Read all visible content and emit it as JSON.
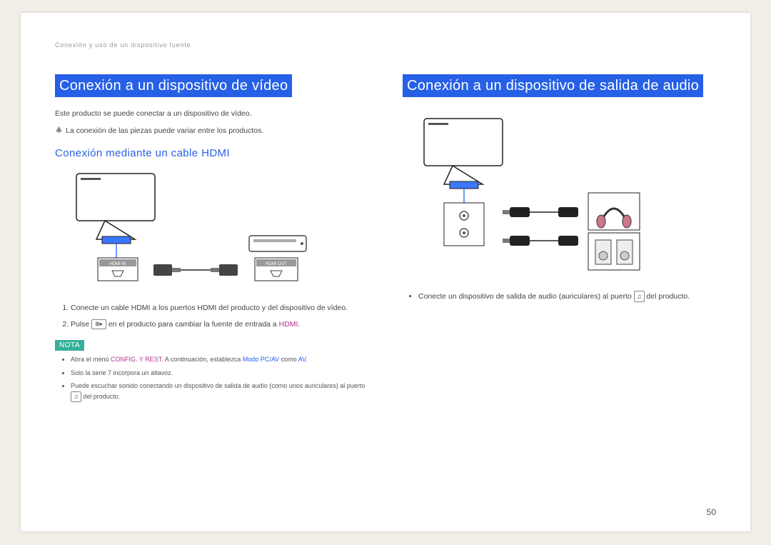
{
  "breadcrumb": "Conexión y uso de un dispositivo fuente",
  "page_number": "50",
  "left": {
    "heading": "Conexión a un dispositivo de vídeo",
    "intro": "Este producto se puede conectar a un dispositivo de vídeo.",
    "info_note": "La conexión de las piezas puede variar entre los productos.",
    "subheading": "Conexión mediante un cable HDMI",
    "labels": {
      "hdmi_in": "HDMI IN",
      "hdmi_out": "HDMI OUT"
    },
    "step1": "Conecte un cable HDMI a los puertos HDMI del producto y del dispositivo de vídeo.",
    "step2_pre": "Pulse ",
    "step2_post": " en el producto para cambiar la fuente de entrada a ",
    "step2_hdmi": "HDMI",
    "source_btn_glyph": "⊞▸",
    "note_label": "NOTA",
    "note1_a": "Abra el menú ",
    "note1_config": "CONFIG. Y REST.",
    "note1_b": " A continuación, establezca ",
    "note1_mode": "Modo PC/AV",
    "note1_c": " como ",
    "note1_av": "AV",
    "note1_end": ".",
    "note2": "Solo la serie 7 incorpora un altavoz.",
    "note3_a": "Puede escuchar sonido conectando un dispositivo de salida de audio (como unos auriculares) al puerto ",
    "note3_b": " del producto.",
    "headphone_glyph": "♫"
  },
  "right": {
    "heading": "Conexión a un dispositivo de salida de audio",
    "step1_a": "Conecte un dispositivo de salida de audio (auriculares) al puerto ",
    "step1_b": " del producto.",
    "headphone_glyph": "♫"
  }
}
